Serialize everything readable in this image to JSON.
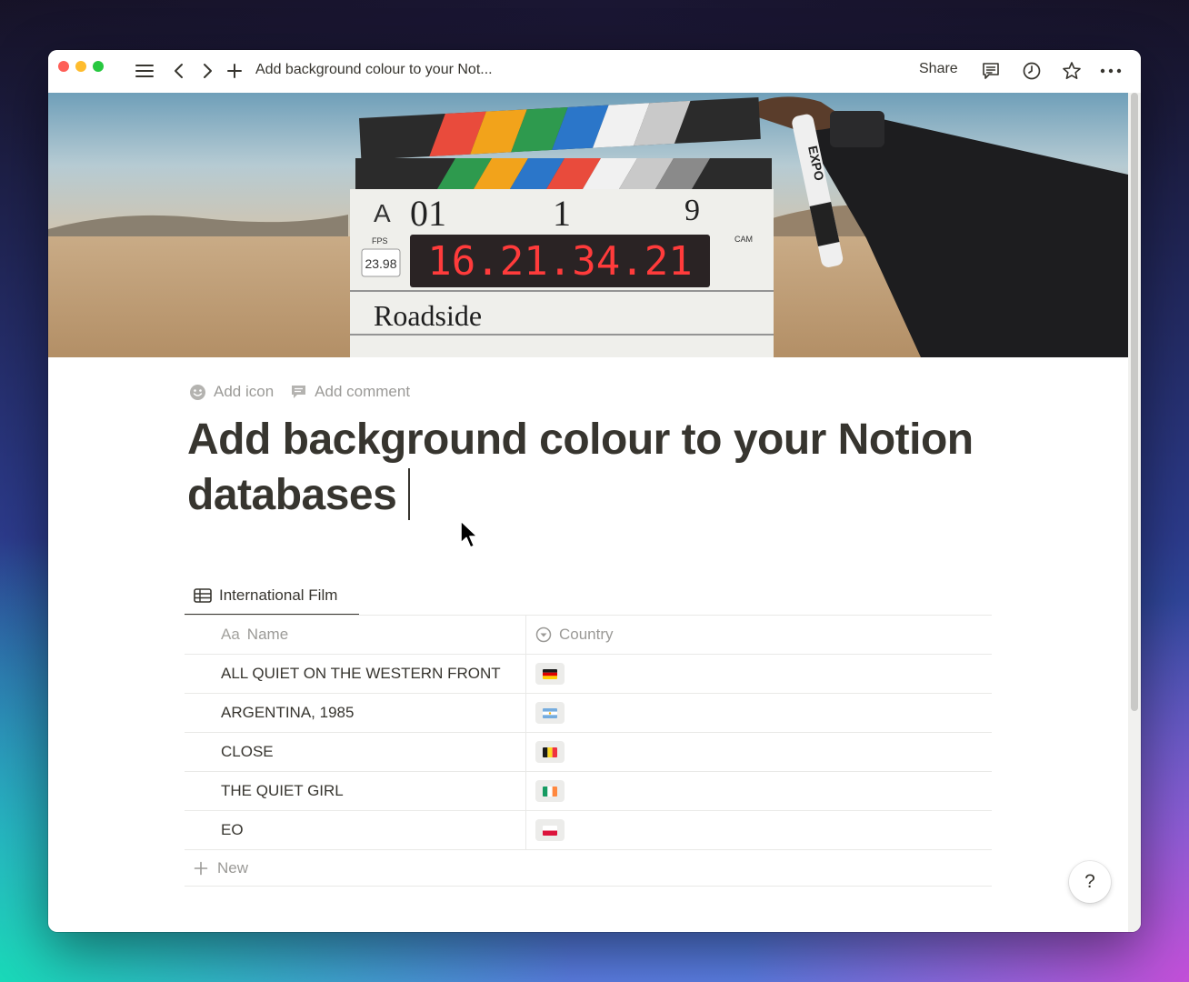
{
  "titlebar": {
    "title": "Add background colour to your Not...",
    "share_label": "Share"
  },
  "page": {
    "add_icon_label": "Add icon",
    "add_comment_label": "Add comment",
    "title": "Add background colour to your Notion databases"
  },
  "cover": {
    "slate_timecode": "16.21.34.21",
    "slate_fps": "23.98",
    "slate_roll": "A",
    "slate_scene_number": "01",
    "slate_scene": "1",
    "slate_take": "9",
    "slate_prod": "Roadside",
    "slate_fps_label": "FPS",
    "slate_cam_label": "CAM",
    "marker_brand": "EXPO"
  },
  "database": {
    "view_name": "International Film",
    "columns": {
      "name_icon": "Aa",
      "name": "Name",
      "country": "Country"
    },
    "rows": [
      {
        "name": "ALL QUIET ON THE WESTERN FRONT",
        "flag": "germany-flag"
      },
      {
        "name": "ARGENTINA, 1985",
        "flag": "argentina-flag"
      },
      {
        "name": "CLOSE",
        "flag": "belgium-flag"
      },
      {
        "name": "THE QUIET GIRL",
        "flag": "ireland-flag"
      },
      {
        "name": "EO",
        "flag": "poland-flag"
      }
    ],
    "new_label": "New"
  },
  "help_label": "?",
  "colors": {
    "text": "#37352f",
    "muted": "#9b9a97",
    "border": "#e9e9e7"
  }
}
